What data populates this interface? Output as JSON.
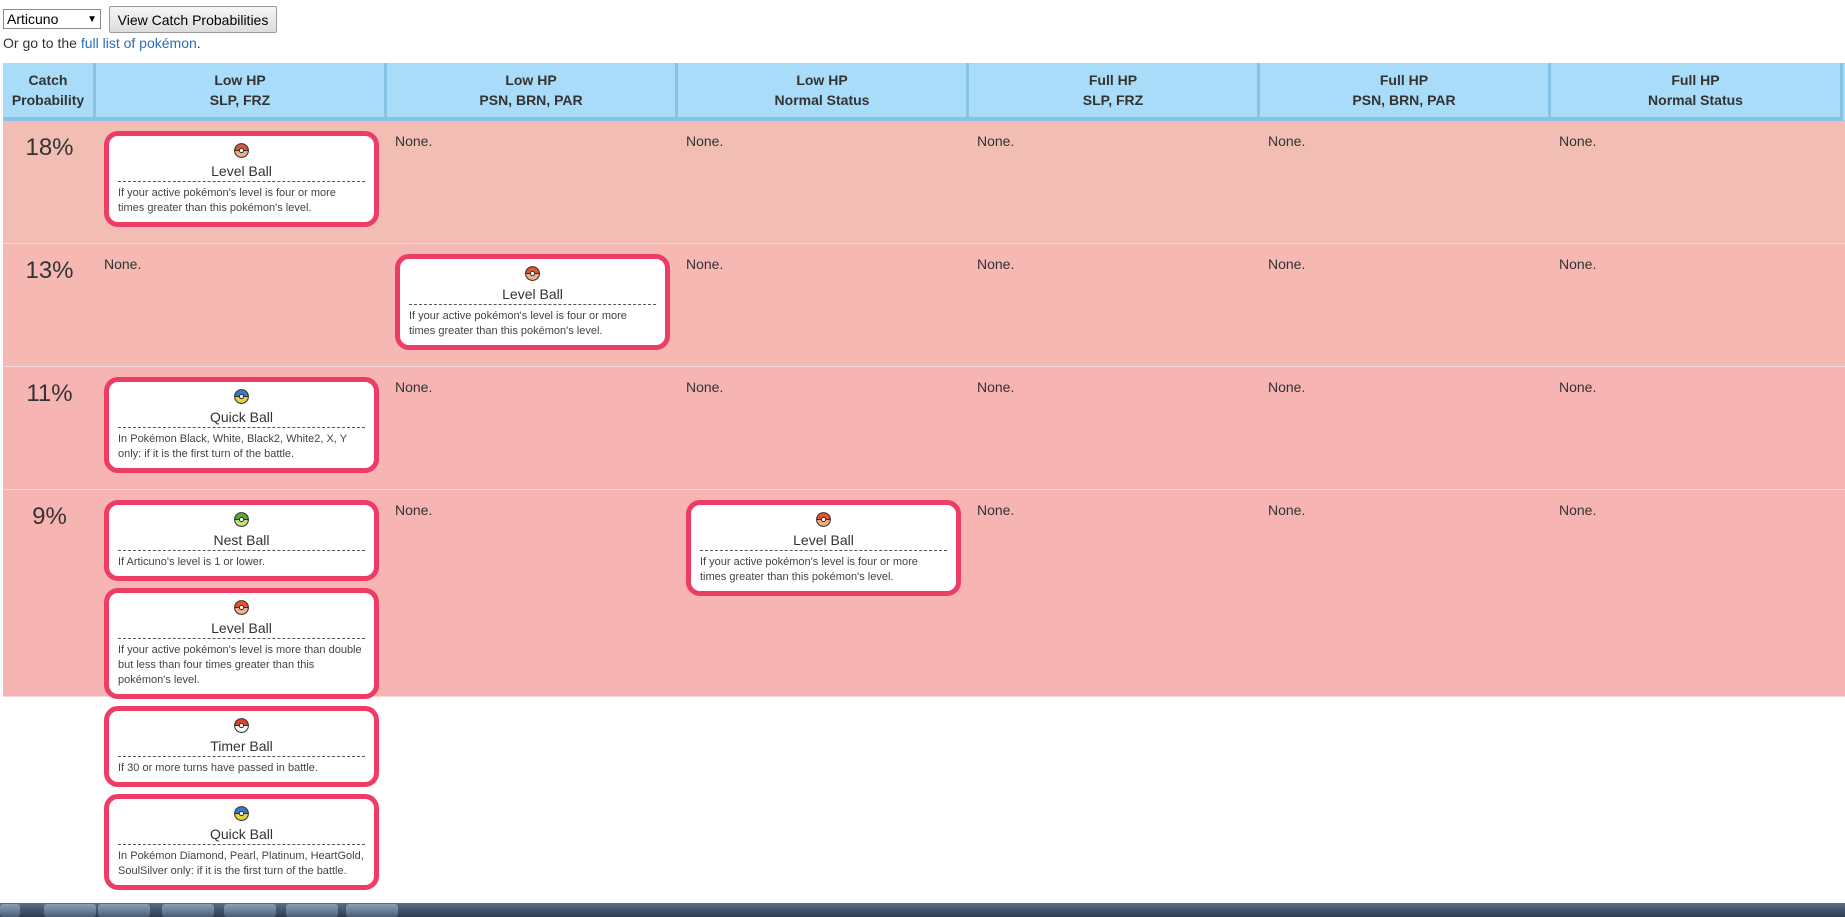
{
  "controls": {
    "pokemon_select_value": "Articuno",
    "view_button_label": "View Catch Probabilities",
    "goto_prefix": "Or go to the ",
    "goto_link": "full list of pokémon",
    "goto_suffix": "."
  },
  "headers": [
    {
      "line1": "Catch",
      "line2": "Probability"
    },
    {
      "line1": "Low HP",
      "line2": "SLP, FRZ"
    },
    {
      "line1": "Low HP",
      "line2": "PSN, BRN, PAR"
    },
    {
      "line1": "Low HP",
      "line2": "Normal Status"
    },
    {
      "line1": "Full HP",
      "line2": "SLP, FRZ"
    },
    {
      "line1": "Full HP",
      "line2": "PSN, BRN, PAR"
    },
    {
      "line1": "Full HP",
      "line2": "Normal Status"
    }
  ],
  "none_text": "None.",
  "rows": [
    {
      "probability": "18%",
      "row_color": "#f2bdb3",
      "cells": [
        [
          {
            "name": "Level Ball",
            "icon": "level-ball-icon",
            "condition": "If your active pokémon's level is four or more times greater than this pokémon's level."
          }
        ],
        [],
        [],
        [],
        [],
        []
      ]
    },
    {
      "probability": "13%",
      "row_color": "#f6b8b3",
      "cells": [
        [],
        [
          {
            "name": "Level Ball",
            "icon": "level-ball-icon",
            "condition": "If your active pokémon's level is four or more times greater than this pokémon's level."
          }
        ],
        [],
        [],
        [],
        []
      ]
    },
    {
      "probability": "11%",
      "row_color": "#f6b4b3",
      "cells": [
        [
          {
            "name": "Quick Ball",
            "icon": "quick-ball-icon",
            "condition": "In Pokémon Black, White, Black2, White2, X, Y only: if it is the first turn of the battle."
          }
        ],
        [],
        [],
        [],
        [],
        []
      ]
    },
    {
      "probability": "9%",
      "row_color": "#f6b4b3",
      "cells": [
        [
          {
            "name": "Nest Ball",
            "icon": "nest-ball-icon",
            "condition": "If Articuno's level is 1 or lower."
          },
          {
            "name": "Level Ball",
            "icon": "level-ball-icon",
            "condition": "If your active pokémon's level is more than double but less than four times greater than this pokémon's level."
          },
          {
            "name": "Timer Ball",
            "icon": "timer-ball-icon",
            "condition": "If 30 or more turns have passed in battle."
          },
          {
            "name": "Quick Ball",
            "icon": "quick-ball-icon",
            "condition": "In Pokémon Diamond, Pearl, Platinum, HeartGold, SoulSilver only: if it is the first turn of the battle."
          }
        ],
        [],
        [
          {
            "name": "Level Ball",
            "icon": "level-ball-icon",
            "condition": "If your active pokémon's level is four or more times greater than this pokémon's level."
          }
        ],
        [],
        [],
        []
      ]
    }
  ],
  "colors": {
    "header_bg": "#a9dcf8",
    "card_border": "#ed3d66",
    "link": "#2a6ebb"
  }
}
